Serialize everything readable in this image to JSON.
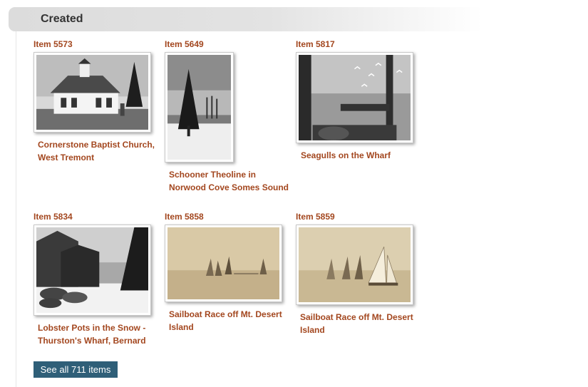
{
  "section": {
    "title": "Created"
  },
  "items": [
    {
      "id_label": "Item 5573",
      "caption": "Cornerstone Baptist Church, West Tremont"
    },
    {
      "id_label": "Item 5649",
      "caption": "Schooner Theoline in Norwood Cove Somes Sound"
    },
    {
      "id_label": "Item 5817",
      "caption": "Seagulls on the Wharf"
    },
    {
      "id_label": "Item 5834",
      "caption": "Lobster Pots in the Snow - Thurston's Wharf, Bernard"
    },
    {
      "id_label": "Item 5858",
      "caption": "Sailboat Race off Mt. Desert Island"
    },
    {
      "id_label": "Item 5859",
      "caption": "Sailboat Race off Mt. Desert Island"
    }
  ],
  "see_all": {
    "label": "See all 711 items"
  },
  "colors": {
    "link": "#a3471f",
    "button": "#2f5f78",
    "header_text": "#333333"
  }
}
